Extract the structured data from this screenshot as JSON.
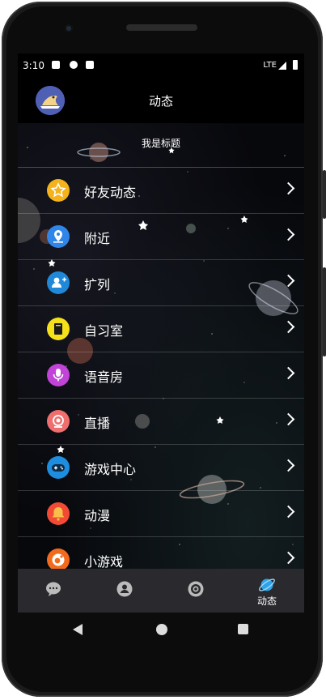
{
  "status_bar": {
    "time": "3:10",
    "network": "LTE"
  },
  "header": {
    "title": "动态"
  },
  "section": {
    "title": "我是标题"
  },
  "menu": [
    {
      "label": "好友动态",
      "icon": "star-icon",
      "color": "#f4b21b"
    },
    {
      "label": "附近",
      "icon": "location-pin-icon",
      "color": "#2f86e8"
    },
    {
      "label": "扩列",
      "icon": "add-friend-icon",
      "color": "#1f88d9"
    },
    {
      "label": "自习室",
      "icon": "book-icon",
      "color": "#f5e11a"
    },
    {
      "label": "语音房",
      "icon": "microphone-icon",
      "color": "#c143d8"
    },
    {
      "label": "直播",
      "icon": "live-camera-icon",
      "color": "#ef6f6f"
    },
    {
      "label": "游戏中心",
      "icon": "gamepad-icon",
      "color": "#1d8de0"
    },
    {
      "label": "动漫",
      "icon": "bell-icon",
      "color": "#f24a35"
    },
    {
      "label": "小游戏",
      "icon": "mini-game-icon",
      "color": "#f26b1d"
    }
  ],
  "bottom_nav": [
    {
      "label": "",
      "icon": "chat-bubble-icon"
    },
    {
      "label": "",
      "icon": "profile-icon"
    },
    {
      "label": "",
      "icon": "discover-icon"
    },
    {
      "label": "动态",
      "icon": "planet-icon",
      "active": true
    }
  ]
}
